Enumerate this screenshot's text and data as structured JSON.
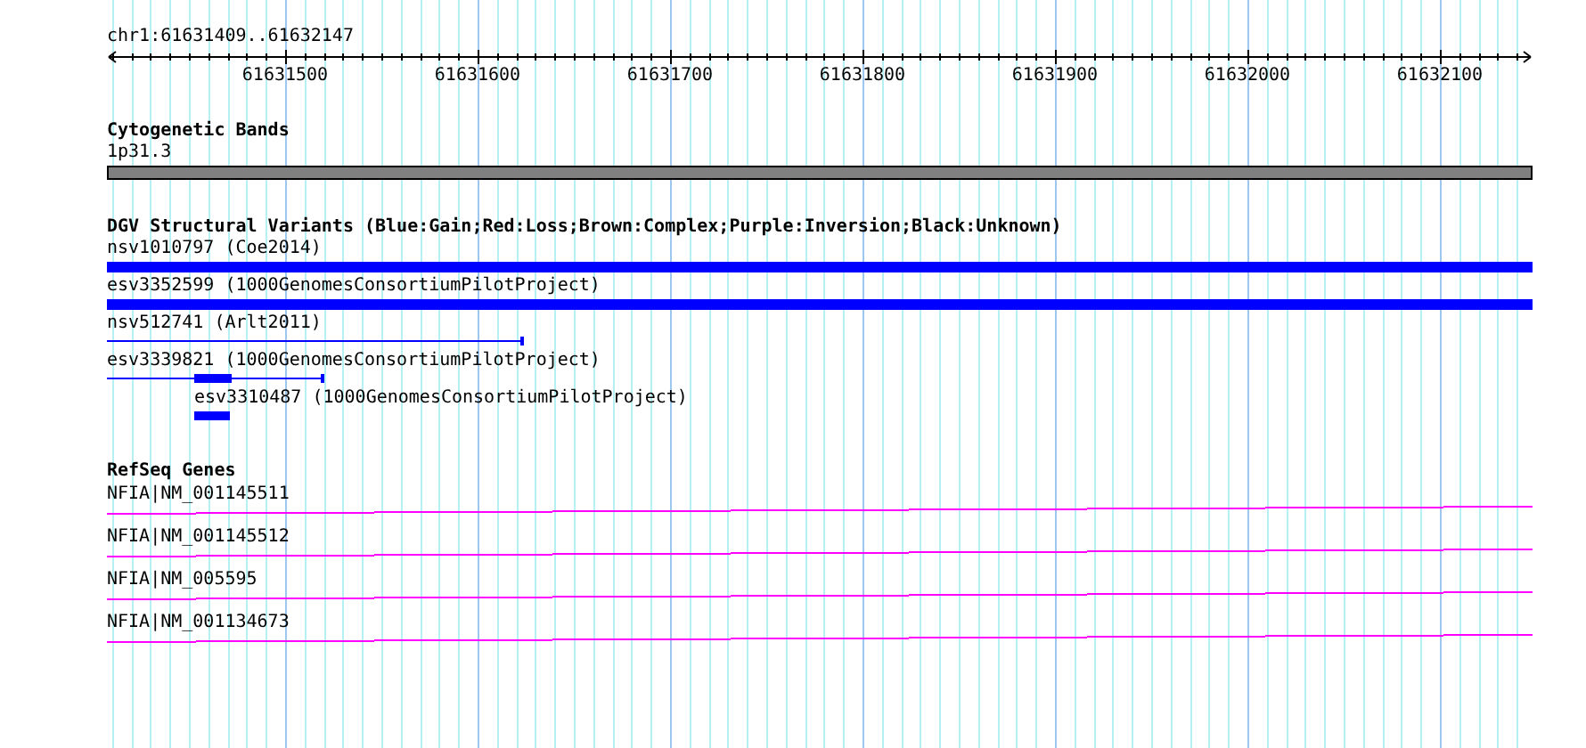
{
  "ruler": {
    "region": "chr1:61631409..61632147",
    "ticks": [
      "61631500",
      "61631600",
      "61631700",
      "61631800",
      "61631900",
      "61632000",
      "61632100"
    ]
  },
  "cytogenetic_bands": {
    "title": "Cytogenetic Bands",
    "bands": [
      {
        "label": "1p31.3"
      }
    ]
  },
  "structural_variants": {
    "title": "DGV Structural Variants (Blue:Gain;Red:Loss;Brown:Complex;Purple:Inversion;Black:Unknown)",
    "features": [
      {
        "label": "nsv1010797 (Coe2014)",
        "kind": "bar",
        "color": "#0000ff"
      },
      {
        "label": "esv3352599 (1000GenomesConsortiumPilotProject)",
        "kind": "bar",
        "color": "#0000ff"
      },
      {
        "label": "nsv512741 (Arlt2011)",
        "kind": "line",
        "color": "#0000ff"
      },
      {
        "label": "esv3339821 (1000GenomesConsortiumPilotProject)",
        "kind": "line-block",
        "color": "#0000ff"
      },
      {
        "label": "esv3310487 (1000GenomesConsortiumPilotProject)",
        "kind": "block",
        "color": "#0000ff"
      }
    ]
  },
  "refseq_genes": {
    "title": "RefSeq Genes",
    "genes": [
      {
        "label": "NFIA|NM_001145511"
      },
      {
        "label": "NFIA|NM_001145512"
      },
      {
        "label": "NFIA|NM_005595"
      },
      {
        "label": "NFIA|NM_001134673"
      }
    ]
  }
}
